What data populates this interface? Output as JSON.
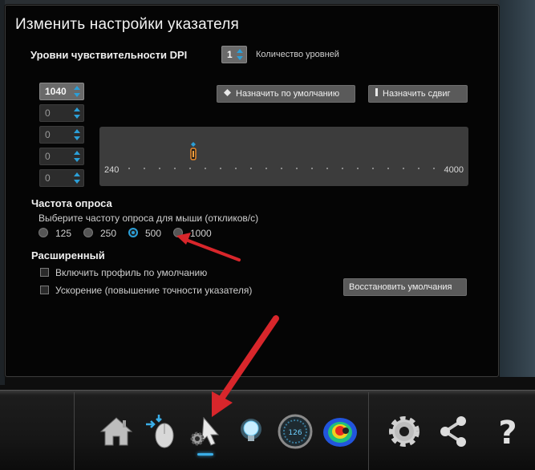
{
  "dialog": {
    "title": "Изменить настройки указателя"
  },
  "dpi": {
    "section_label": "Уровни чувствительности DPI",
    "levels_count": "1",
    "levels_count_label": "Количество уровней",
    "levels": [
      "1040",
      "0",
      "0",
      "0",
      "0"
    ],
    "set_default_label": "Назначить по умолчанию",
    "set_shift_label": "Назначить сдвиг",
    "slider_min": "240",
    "slider_max": "4000",
    "slider_value": 1040
  },
  "polling": {
    "section_label": "Частота опроса",
    "hint": "Выберите частоту опроса для мыши (откликов/с)",
    "options": [
      "125",
      "250",
      "500",
      "1000"
    ],
    "selected": "500"
  },
  "advanced": {
    "section_label": "Расширенный",
    "enable_default_profile": "Включить профиль по умолчанию",
    "acceleration": "Ускорение (повышение точности указателя)",
    "restore_defaults": "Восстановить умолчания"
  },
  "taskbar": {
    "icons": [
      "home-icon",
      "mouse-buttons-icon",
      "pointer-settings-icon",
      "light-bulb-icon",
      "speedometer-icon",
      "heatmap-icon",
      "gear-icon",
      "share-icon",
      "help-icon"
    ],
    "gauge_text": "126",
    "help_glyph": "?"
  },
  "colors": {
    "accent": "#2b9fd8",
    "annotation_arrow": "#d8262b",
    "slider_thumb": "#e8892a"
  }
}
